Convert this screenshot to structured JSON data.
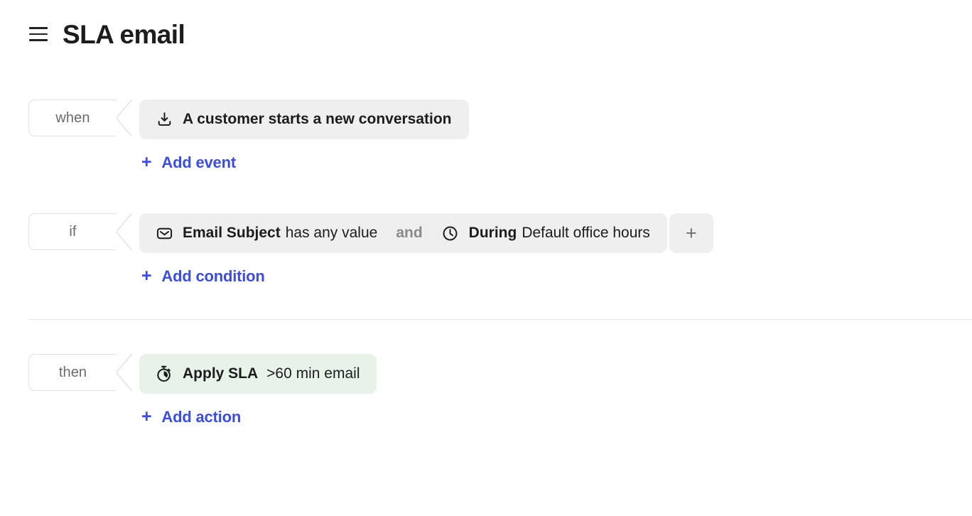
{
  "header": {
    "menu_icon": "hamburger-icon",
    "title": "SLA email"
  },
  "theme": {
    "link_blue": "#3b4de8",
    "chip_gray": "#efefef",
    "chip_green": "#e7f3e9",
    "tag_border": "#e2e2e2",
    "muted_text": "#8a8a8a",
    "divider": "#e4e4e4"
  },
  "blocks": {
    "when": {
      "tag_label": "when",
      "event": {
        "icon": "inbox-download-icon",
        "label": "A customer starts a new conversation"
      },
      "add_label": "Add event",
      "add_plus": "+"
    },
    "if": {
      "tag_label": "if",
      "conditions": [
        {
          "icon": "envelope-icon",
          "subject": "Email Subject",
          "predicate": "has any value"
        },
        {
          "icon": "clock-icon",
          "subject": "During",
          "predicate": "Default office hours"
        }
      ],
      "operator": "and",
      "add_condition_plus": "+",
      "add_label": "Add condition",
      "add_plus": "+"
    },
    "then": {
      "tag_label": "then",
      "action": {
        "icon": "stopwatch-icon",
        "label": "Apply SLA",
        "value": ">60 min email"
      },
      "add_label": "Add action",
      "add_plus": "+"
    }
  }
}
